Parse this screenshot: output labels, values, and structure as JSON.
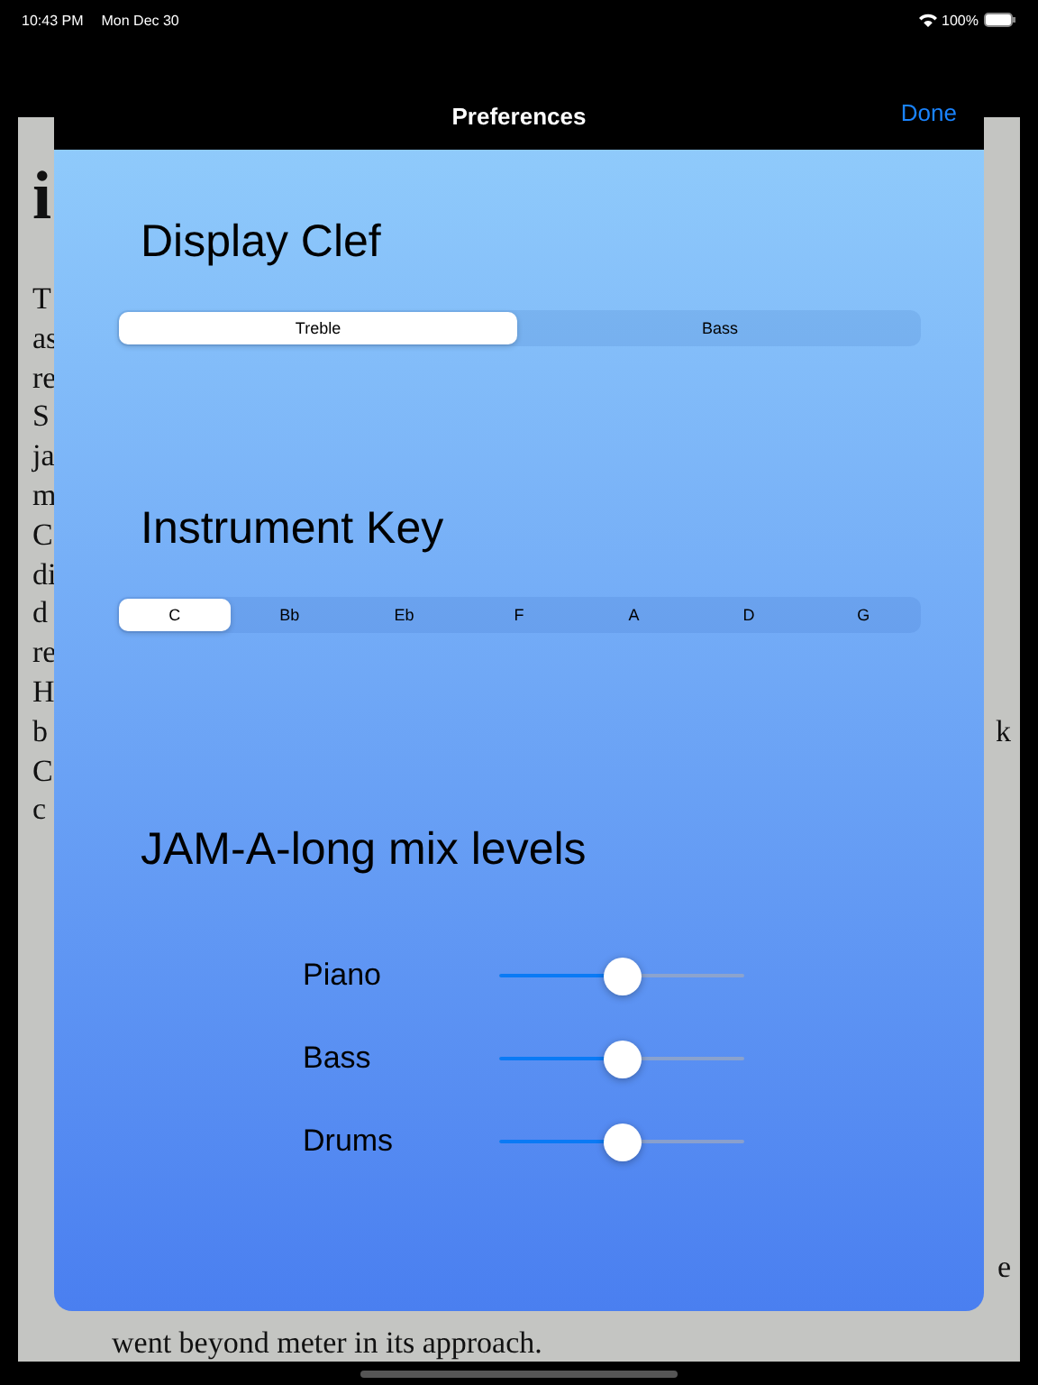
{
  "status_bar": {
    "time": "10:43 PM",
    "date": "Mon Dec 30",
    "battery": "100%"
  },
  "background_page": {
    "heading": "i",
    "left_fragments": [
      "T",
      "as",
      "re",
      "S",
      "ja",
      "m",
      "C",
      "di",
      "d",
      "re",
      "H",
      "b",
      "C",
      "c"
    ],
    "right_fragments": [
      "k",
      "e"
    ],
    "last_line": "went beyond meter in its approach."
  },
  "dialog": {
    "title": "Preferences",
    "done": "Done",
    "sections": [
      {
        "kind": "segmented",
        "title": "Display Clef",
        "options": [
          {
            "label": "Treble",
            "selected": true
          },
          {
            "label": "Bass",
            "selected": false
          }
        ]
      },
      {
        "kind": "segmented",
        "title": "Instrument Key",
        "options": [
          {
            "label": "C",
            "selected": true
          },
          {
            "label": "Bb",
            "selected": false
          },
          {
            "label": "Eb",
            "selected": false
          },
          {
            "label": "F",
            "selected": false
          },
          {
            "label": "A",
            "selected": false
          },
          {
            "label": "D",
            "selected": false
          },
          {
            "label": "G",
            "selected": false
          }
        ]
      },
      {
        "kind": "sliders",
        "title": "JAM-A-long mix levels",
        "sliders": [
          {
            "label": "Piano",
            "level": 0.5
          },
          {
            "label": "Bass",
            "level": 0.5
          },
          {
            "label": "Drums",
            "level": 0.5
          }
        ]
      }
    ]
  }
}
